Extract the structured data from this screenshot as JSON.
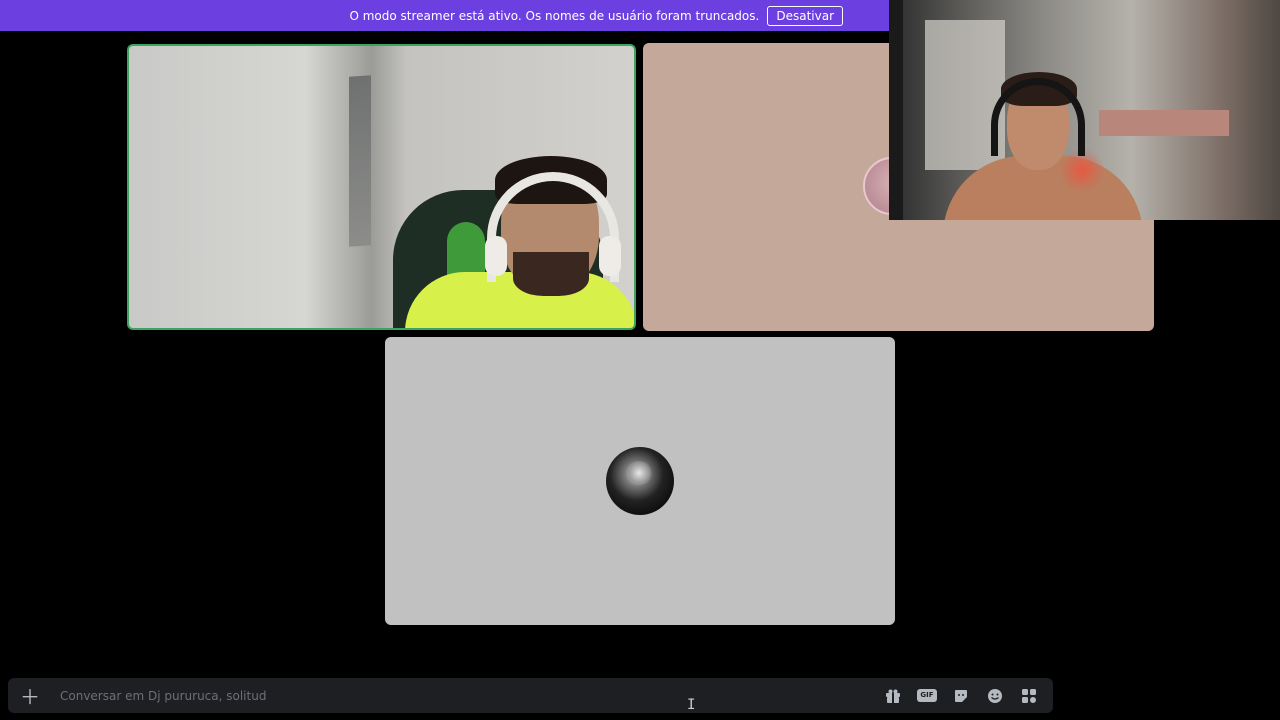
{
  "banner": {
    "message": "O modo streamer está ativo. Os nomes de usuário foram truncados.",
    "button_label": "Desativar",
    "color": "#6b3fe0"
  },
  "tiles": [
    {
      "name": "participant-video",
      "speaking": true,
      "border_color": "#3ba55d"
    },
    {
      "name": "participant-avatar-tile",
      "background": "#c4a89a"
    },
    {
      "name": "participant-avatar-tile",
      "background": "#c1c1c1"
    }
  ],
  "overlay_cam": {
    "icon": "webcam-overlay"
  },
  "chat": {
    "add_icon": "plus-icon",
    "placeholder": "Conversar em Dj pururuca, solitud",
    "icons": [
      "gift-icon",
      "gif-icon",
      "sticker-icon",
      "emoji-icon",
      "apps-icon"
    ],
    "gif_label": "GIF"
  },
  "cursor_glyph": "I"
}
